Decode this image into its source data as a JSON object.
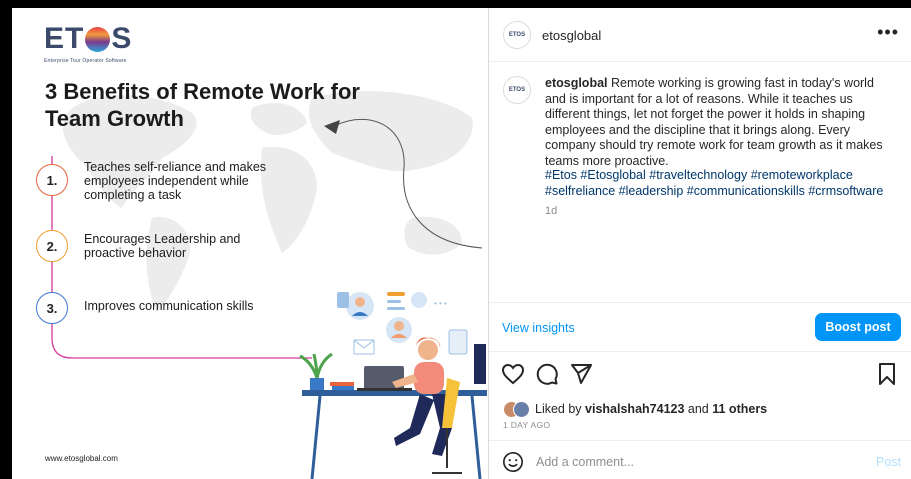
{
  "media": {
    "logo": {
      "text_left": "ET",
      "text_right": "S",
      "tagline": "Enterprise Tour Operator Software"
    },
    "headline": "3 Benefits of Remote Work for Team Growth",
    "benefits": [
      {
        "number": "1.",
        "text": "Teaches self-reliance and makes employees independent while completing a task",
        "color": "#e8643c"
      },
      {
        "number": "2.",
        "text": "Encourages Leadership and proactive behavior",
        "color": "#f0a030"
      },
      {
        "number": "3.",
        "text": "Improves communication skills",
        "color": "#3a78c8"
      }
    ],
    "website": "www.etosglobal.com",
    "accent_line_color": "#d63aa0"
  },
  "panel": {
    "header": {
      "avatar_text": "ETOS",
      "username": "etosglobal",
      "more_icon": "more-horizontal-icon"
    },
    "caption": {
      "username": "etosglobal",
      "text": "Remote working is growing fast in today's world and is important for a lot of reasons. While it teaches us different things, let not forget the power it holds in shaping employees and the discipline that it brings along. Every company should try remote work for team growth as it makes teams more proactive.",
      "hashtags": "#Etos #Etosglobal #traveltechnology #remoteworkplace #selfreliance #leadership #communicationskills #crmsoftware",
      "age": "1d"
    },
    "insights": {
      "view_label": "View insights",
      "boost_label": "Boost post"
    },
    "actions": {
      "like_icon": "heart-icon",
      "comment_icon": "comment-icon",
      "share_icon": "send-icon",
      "save_icon": "bookmark-icon"
    },
    "likes": {
      "prefix": "Liked by",
      "user": "vishalshah74123",
      "connector": "and",
      "others": "11 others"
    },
    "timestamp": "1 DAY AGO",
    "comment": {
      "placeholder": "Add a comment...",
      "post_label": "Post",
      "emoji_icon": "smiley-icon"
    },
    "colors": {
      "accent": "#0095f6",
      "link": "#00376b",
      "muted": "#8e8e8e"
    }
  }
}
